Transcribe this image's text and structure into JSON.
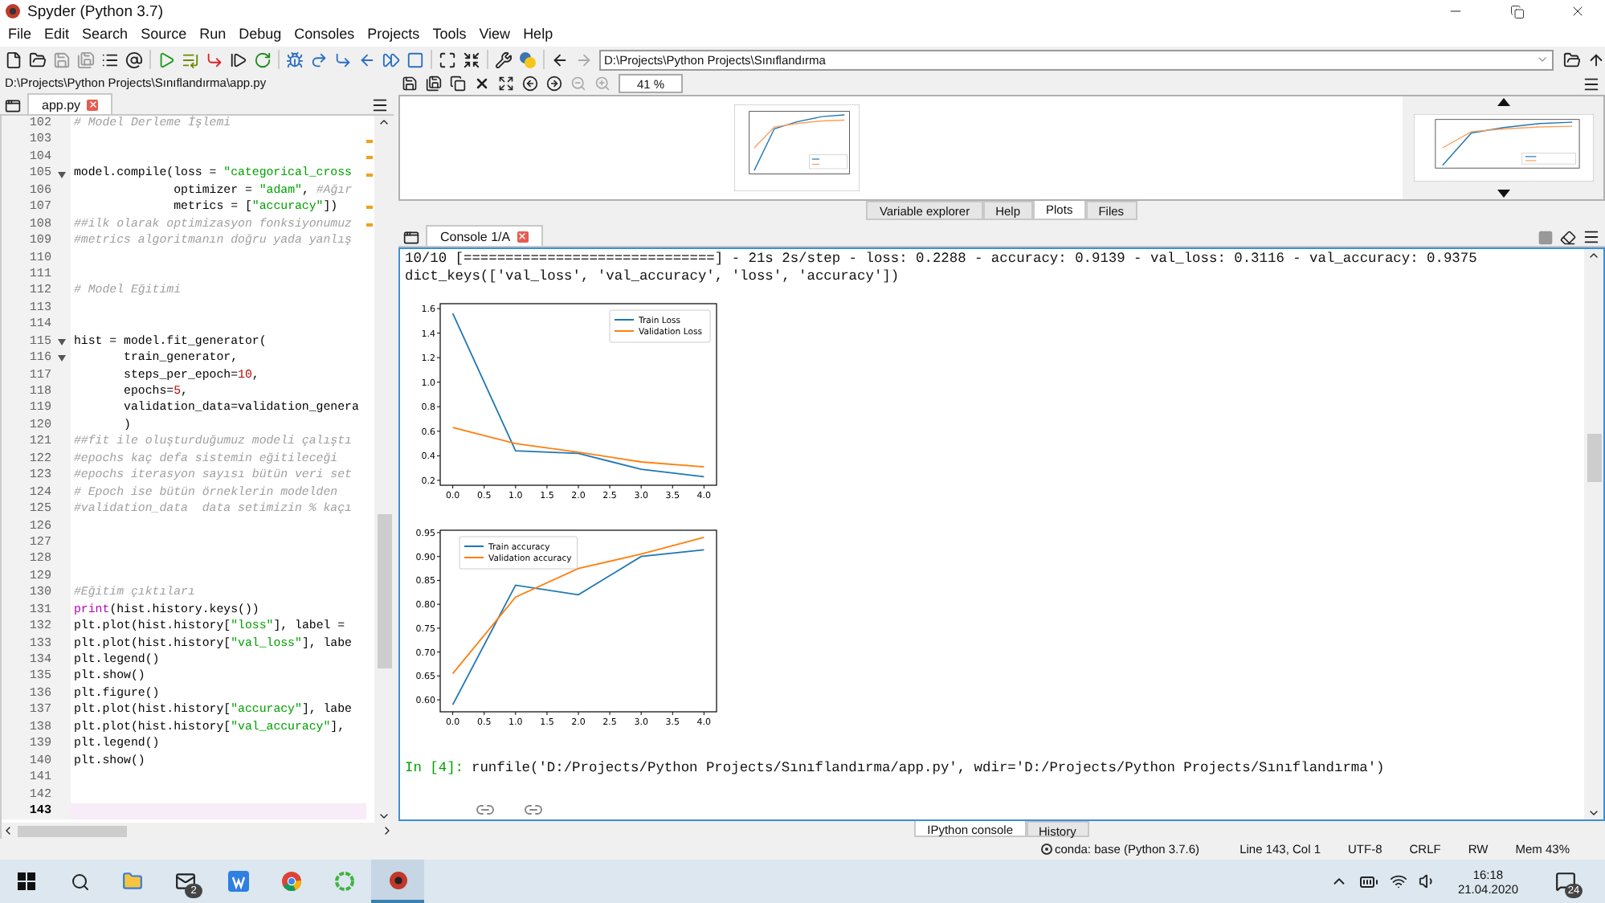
{
  "window": {
    "title": "Spyder (Python 3.7)"
  },
  "menu": [
    "File",
    "Edit",
    "Search",
    "Source",
    "Run",
    "Debug",
    "Consoles",
    "Projects",
    "Tools",
    "View",
    "Help"
  ],
  "toolbar": {
    "working_directory": "D:\\Projects\\Python Projects\\Sınıflandırma"
  },
  "editor": {
    "file_path": "D:\\Projects\\Python Projects\\Sınıflandırma\\app.py",
    "tabs": [
      {
        "label": "app.py",
        "selected": true
      }
    ],
    "lines": [
      {
        "n": "102",
        "fold": false,
        "current": false,
        "warning": false,
        "segs": [
          {
            "kind": "comment",
            "text": "# Model Derleme İşlemi"
          }
        ]
      },
      {
        "n": "103",
        "fold": false,
        "current": false,
        "warning": true
      },
      {
        "n": "104",
        "fold": false,
        "current": false,
        "warning": true
      },
      {
        "n": "105",
        "fold": true,
        "current": false,
        "warning": true,
        "segs": [
          {
            "kind": "plain",
            "text": "model.compile(loss = "
          },
          {
            "kind": "string",
            "text": "\"categorical_cross"
          }
        ]
      },
      {
        "n": "106",
        "fold": false,
        "current": false,
        "warning": false,
        "segs": [
          {
            "kind": "plain",
            "text": "              optimizer = "
          },
          {
            "kind": "string",
            "text": "\"adam\""
          },
          {
            "kind": "plain",
            "text": ", "
          },
          {
            "kind": "comment",
            "text": "#Ağır"
          }
        ]
      },
      {
        "n": "107",
        "fold": false,
        "current": false,
        "warning": true,
        "segs": [
          {
            "kind": "plain",
            "text": "              metrics = ["
          },
          {
            "kind": "string",
            "text": "\"accuracy\""
          },
          {
            "kind": "plain",
            "text": "])"
          }
        ]
      },
      {
        "n": "108",
        "fold": false,
        "current": false,
        "warning": true,
        "segs": [
          {
            "kind": "comment",
            "text": "##ilk olarak optimizasyon fonksiyonumuz"
          }
        ]
      },
      {
        "n": "109",
        "fold": false,
        "current": false,
        "warning": false,
        "segs": [
          {
            "kind": "comment",
            "text": "#metrics algoritmanın doğru yada yanlış"
          }
        ]
      },
      {
        "n": "110",
        "fold": false,
        "current": false,
        "warning": false
      },
      {
        "n": "111",
        "fold": false,
        "current": false,
        "warning": false
      },
      {
        "n": "112",
        "fold": false,
        "current": false,
        "warning": false,
        "segs": [
          {
            "kind": "comment",
            "text": "# Model Eğitimi"
          }
        ]
      },
      {
        "n": "113",
        "fold": false,
        "current": false,
        "warning": false
      },
      {
        "n": "114",
        "fold": false,
        "current": false,
        "warning": false
      },
      {
        "n": "115",
        "fold": true,
        "current": false,
        "warning": false,
        "segs": [
          {
            "kind": "plain",
            "text": "hist = model.fit_generator("
          }
        ]
      },
      {
        "n": "116",
        "fold": true,
        "current": false,
        "warning": false,
        "segs": [
          {
            "kind": "plain",
            "text": "       train_generator,"
          }
        ]
      },
      {
        "n": "117",
        "fold": false,
        "current": false,
        "warning": false,
        "segs": [
          {
            "kind": "plain",
            "text": "       steps_per_epoch="
          },
          {
            "kind": "number",
            "text": "10"
          },
          {
            "kind": "plain",
            "text": ","
          }
        ]
      },
      {
        "n": "118",
        "fold": false,
        "current": false,
        "warning": false,
        "segs": [
          {
            "kind": "plain",
            "text": "       epochs="
          },
          {
            "kind": "number",
            "text": "5"
          },
          {
            "kind": "plain",
            "text": ","
          }
        ]
      },
      {
        "n": "119",
        "fold": false,
        "current": false,
        "warning": false,
        "segs": [
          {
            "kind": "plain",
            "text": "       validation_data=validation_genera"
          }
        ]
      },
      {
        "n": "120",
        "fold": false,
        "current": false,
        "warning": false,
        "segs": [
          {
            "kind": "plain",
            "text": "       )"
          }
        ]
      },
      {
        "n": "121",
        "fold": false,
        "current": false,
        "warning": false,
        "segs": [
          {
            "kind": "comment",
            "text": "##fit ile oluşturduğumuz modeli çalıştı"
          }
        ]
      },
      {
        "n": "122",
        "fold": false,
        "current": false,
        "warning": false,
        "segs": [
          {
            "kind": "comment",
            "text": "#epochs kaç defa sistemin eğitileceği"
          }
        ]
      },
      {
        "n": "123",
        "fold": false,
        "current": false,
        "warning": false,
        "segs": [
          {
            "kind": "comment",
            "text": "#epochs iterasyon sayısı bütün veri set"
          }
        ]
      },
      {
        "n": "124",
        "fold": false,
        "current": false,
        "warning": false,
        "segs": [
          {
            "kind": "comment",
            "text": "# Epoch ise bütün örneklerin modelden"
          }
        ]
      },
      {
        "n": "125",
        "fold": false,
        "current": false,
        "warning": false,
        "segs": [
          {
            "kind": "comment",
            "text": "#validation_data  data setimizin % kaçı"
          }
        ]
      },
      {
        "n": "126",
        "fold": false,
        "current": false,
        "warning": false
      },
      {
        "n": "127",
        "fold": false,
        "current": false,
        "warning": false
      },
      {
        "n": "128",
        "fold": false,
        "current": false,
        "warning": false
      },
      {
        "n": "129",
        "fold": false,
        "current": false,
        "warning": false
      },
      {
        "n": "130",
        "fold": false,
        "current": false,
        "warning": false,
        "segs": [
          {
            "kind": "comment",
            "text": "#Eğitim çıktıları"
          }
        ]
      },
      {
        "n": "131",
        "fold": false,
        "current": false,
        "warning": false,
        "segs": [
          {
            "kind": "builtin",
            "text": "print"
          },
          {
            "kind": "plain",
            "text": "(hist.history.keys())"
          }
        ]
      },
      {
        "n": "132",
        "fold": false,
        "current": false,
        "warning": false,
        "segs": [
          {
            "kind": "plain",
            "text": "plt.plot(hist.history["
          },
          {
            "kind": "string",
            "text": "\"loss\""
          },
          {
            "kind": "plain",
            "text": "], label ="
          }
        ]
      },
      {
        "n": "133",
        "fold": false,
        "current": false,
        "warning": false,
        "segs": [
          {
            "kind": "plain",
            "text": "plt.plot(hist.history["
          },
          {
            "kind": "string",
            "text": "\"val_loss\""
          },
          {
            "kind": "plain",
            "text": "], labe"
          }
        ]
      },
      {
        "n": "134",
        "fold": false,
        "current": false,
        "warning": false,
        "segs": [
          {
            "kind": "plain",
            "text": "plt.legend()"
          }
        ]
      },
      {
        "n": "135",
        "fold": false,
        "current": false,
        "warning": false,
        "segs": [
          {
            "kind": "plain",
            "text": "plt.show()"
          }
        ]
      },
      {
        "n": "136",
        "fold": false,
        "current": false,
        "warning": false,
        "segs": [
          {
            "kind": "plain",
            "text": "plt.figure()"
          }
        ]
      },
      {
        "n": "137",
        "fold": false,
        "current": false,
        "warning": false,
        "segs": [
          {
            "kind": "plain",
            "text": "plt.plot(hist.history["
          },
          {
            "kind": "string",
            "text": "\"accuracy\""
          },
          {
            "kind": "plain",
            "text": "], labe"
          }
        ]
      },
      {
        "n": "138",
        "fold": false,
        "current": false,
        "warning": false,
        "segs": [
          {
            "kind": "plain",
            "text": "plt.plot(hist.history["
          },
          {
            "kind": "string",
            "text": "\"val_accuracy\""
          },
          {
            "kind": "plain",
            "text": "],"
          }
        ]
      },
      {
        "n": "139",
        "fold": false,
        "current": false,
        "warning": false,
        "segs": [
          {
            "kind": "plain",
            "text": "plt.legend()"
          }
        ]
      },
      {
        "n": "140",
        "fold": false,
        "current": false,
        "warning": false,
        "segs": [
          {
            "kind": "plain",
            "text": "plt.show()"
          }
        ]
      },
      {
        "n": "141",
        "fold": false,
        "current": false,
        "warning": false
      },
      {
        "n": "142",
        "fold": false,
        "current": false,
        "warning": false
      },
      {
        "n": "143",
        "fold": false,
        "current": true,
        "warning": false
      }
    ]
  },
  "plots": {
    "zoom": "41 %",
    "pane_tabs": [
      {
        "label": "Variable explorer",
        "selected": false
      },
      {
        "label": "Help",
        "selected": false
      },
      {
        "label": "Plots",
        "selected": true
      },
      {
        "label": "Files",
        "selected": false
      }
    ]
  },
  "console": {
    "tabs": [
      {
        "label": "Console 1/A",
        "selected": true
      }
    ],
    "output": [
      {
        "kind": "text",
        "text": "10/10 [==============================] - 21s 2s/step - loss: 0.2288 - accuracy: 0.9139 - val_loss: 0.3116 - val_accuracy: 0.9375"
      },
      {
        "kind": "text",
        "text": "dict_keys(['val_loss', 'val_accuracy', 'loss', 'accuracy'])"
      },
      {
        "kind": "chart",
        "chart_data": {
          "type": "line",
          "legend": "upper right",
          "x": [
            0,
            1,
            2,
            3,
            4
          ],
          "xlim": [
            -0.2,
            4.2
          ],
          "ylim": [
            0.16,
            1.64
          ],
          "xticks": [
            {
              "value": 0,
              "label": "0.0"
            },
            {
              "value": 0.5,
              "label": "0.5"
            },
            {
              "value": 1,
              "label": "1.0"
            },
            {
              "value": 1.5,
              "label": "1.5"
            },
            {
              "value": 2,
              "label": "2.0"
            },
            {
              "value": 2.5,
              "label": "2.5"
            },
            {
              "value": 3,
              "label": "3.0"
            },
            {
              "value": 3.5,
              "label": "3.5"
            },
            {
              "value": 4,
              "label": "4.0"
            }
          ],
          "yticks": [
            0.2,
            0.4,
            0.6,
            0.8,
            {
              "value": 1,
              "label": "1.0"
            },
            1.2,
            1.4,
            1.6
          ],
          "series": [
            {
              "name": "Train Loss",
              "color": "#1f77b4",
              "values": [
                1.56,
                0.44,
                0.42,
                0.29,
                0.23
              ]
            },
            {
              "name": "Validation Loss",
              "color": "#ff7f0e",
              "values": [
                0.63,
                0.5,
                0.43,
                0.35,
                0.31
              ]
            }
          ]
        }
      },
      {
        "kind": "chart",
        "chart_data": {
          "type": "line",
          "legend": "upper left",
          "x": [
            0,
            1,
            2,
            3,
            4
          ],
          "xlim": [
            -0.2,
            4.2
          ],
          "ylim": [
            0.575,
            0.955
          ],
          "xticks": [
            {
              "value": 0,
              "label": "0.0"
            },
            {
              "value": 0.5,
              "label": "0.5"
            },
            {
              "value": 1,
              "label": "1.0"
            },
            {
              "value": 1.5,
              "label": "1.5"
            },
            {
              "value": 2,
              "label": "2.0"
            },
            {
              "value": 2.5,
              "label": "2.5"
            },
            {
              "value": 3,
              "label": "3.0"
            },
            {
              "value": 3.5,
              "label": "3.5"
            },
            {
              "value": 4,
              "label": "4.0"
            }
          ],
          "yticks": [
            {
              "value": 0.6,
              "label": "0.60"
            },
            {
              "value": 0.65,
              "label": "0.65"
            },
            {
              "value": 0.7,
              "label": "0.70"
            },
            {
              "value": 0.75,
              "label": "0.75"
            },
            {
              "value": 0.8,
              "label": "0.80"
            },
            {
              "value": 0.85,
              "label": "0.85"
            },
            {
              "value": 0.9,
              "label": "0.90"
            },
            {
              "value": 0.95,
              "label": "0.95"
            }
          ],
          "series": [
            {
              "name": "Train accuracy",
              "color": "#1f77b4",
              "values": [
                0.59,
                0.84,
                0.82,
                0.9,
                0.914
              ]
            },
            {
              "name": "Validation accuracy",
              "color": "#ff7f0e",
              "values": [
                0.655,
                0.815,
                0.875,
                0.905,
                0.94
              ]
            }
          ]
        }
      },
      {
        "kind": "prompt",
        "prompt": "In [4]:",
        "text": "runfile('D:/Projects/Python Projects/Sınıflandırma/app.py', wdir='D:/Projects/Python Projects/Sınıflandırma')"
      }
    ],
    "bottom_tabs": [
      {
        "label": "IPython console",
        "selected": true
      },
      {
        "label": "History",
        "selected": false
      }
    ]
  },
  "status_bar": {
    "environment": "conda: base (Python 3.7.6)",
    "items": [
      "Line 143, Col 1",
      "UTF-8",
      "CRLF",
      "RW",
      "Mem 43%"
    ]
  },
  "taskbar": {
    "mail_badge": "2",
    "time": "16:18",
    "date": "21.04.2020",
    "notification_count": "24"
  }
}
